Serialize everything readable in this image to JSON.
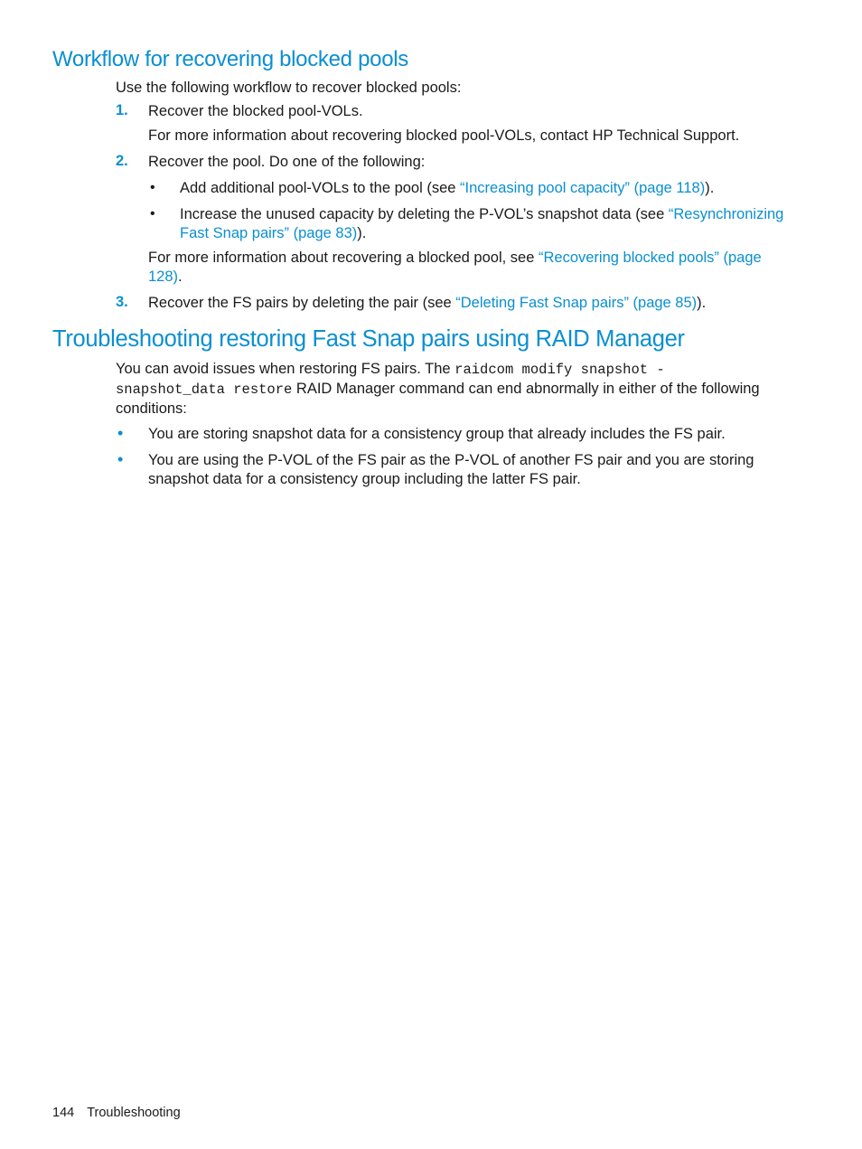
{
  "section1": {
    "title": "Workflow for recovering blocked pools",
    "intro": "Use the following workflow to recover blocked pools:",
    "steps": [
      {
        "num": "1.",
        "text": "Recover the blocked pool-VOLs.",
        "note": "For more information about recovering blocked pool-VOLs, contact HP Technical Support."
      },
      {
        "num": "2.",
        "text": "Recover the pool. Do one of the following:",
        "bullets": [
          {
            "pre": "Add additional pool-VOLs to the pool (see ",
            "link": "“Increasing pool capacity” (page 118)",
            "post": ")."
          },
          {
            "pre": "Increase the unused capacity by deleting the P-VOL’s snapshot data (see ",
            "link": "“Resynchronizing Fast Snap pairs” (page 83)",
            "post": ")."
          }
        ],
        "note_pre": "For more information about recovering a blocked pool, see ",
        "note_link": "“Recovering blocked pools” (page 128)",
        "note_post": "."
      },
      {
        "num": "3.",
        "pre": "Recover the FS pairs by deleting the pair (see ",
        "link": "“Deleting Fast Snap pairs” (page 85)",
        "post": ")."
      }
    ]
  },
  "section2": {
    "title": "Troubleshooting restoring Fast Snap pairs using RAID Manager",
    "intro_pre": "You can avoid issues when restoring FS pairs. The ",
    "intro_code": "raidcom modify snapshot -snapshot_data restore",
    "intro_post": " RAID Manager command can end abnormally in either of the following conditions:",
    "bullets": [
      "You are storing snapshot data for a consistency group that already includes the FS pair.",
      "You are using the P-VOL of the FS pair as the P-VOL of another FS pair and you are storing snapshot data for a consistency group including the latter FS pair."
    ]
  },
  "footer": {
    "page_number": "144",
    "chapter": "Troubleshooting"
  }
}
